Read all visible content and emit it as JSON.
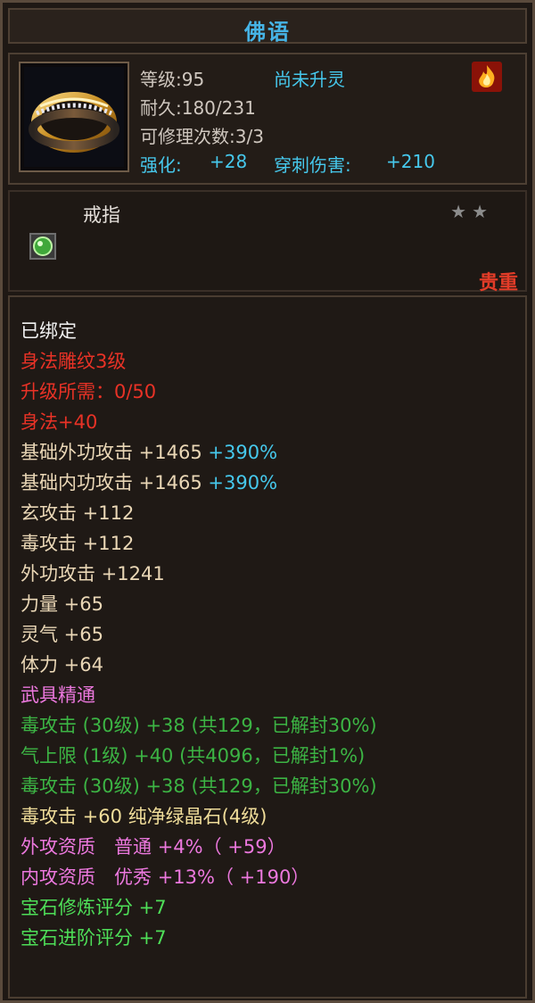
{
  "title": "佛语",
  "header": {
    "level_label": "等级:95",
    "spirit_status": "尚未升灵",
    "durability": "耐久:180/231",
    "repair_count": "可修理次数:3/3",
    "enhance_label": "强化:",
    "enhance_value": "+28",
    "pierce_label": "穿刺伤害:",
    "pierce_value": "+210"
  },
  "item_type": "戒指",
  "stars": "★★",
  "rarity": "贵重",
  "colors": {
    "title": "#46b4e6",
    "cyan": "#46c8ec",
    "red": "#e83226",
    "pink": "#ec78de",
    "green": "#3cb444",
    "bright_green": "#4ede58"
  },
  "icons": [
    "ring-item-icon",
    "fire-icon",
    "green-gem-icon"
  ],
  "attributes": {
    "bound": "已绑定",
    "carving": "身法雕纹3级",
    "upgrade_need": "升级所需：0/50",
    "agility": "身法+40",
    "base_ext_atk": "基础外功攻击 +1465",
    "base_ext_atk_pct": "+390%",
    "base_int_atk": "基础内功攻击 +1465",
    "base_int_atk_pct": "+390%",
    "xuan_atk": "玄攻击 +112",
    "poison_atk": "毒攻击 +112",
    "ext_atk": "外功攻击 +1241",
    "strength": "力量 +65",
    "spirit": "灵气 +65",
    "stamina": "体力 +64",
    "weapon_mastery": "武具精通",
    "mastery_1": "毒攻击 (30级) +38 (共129，已解封30%)",
    "mastery_2": "气上限 (1级) +40 (共4096，已解封1%)",
    "mastery_3": "毒攻击 (30级) +38 (共129，已解封30%)",
    "gem_line_left": "毒攻击 +60",
    "gem_line_right": "纯净绿晶石(4级)",
    "ext_aptitude_label": "外攻资质　普通",
    "ext_aptitude_value": "+4%（ +59）",
    "int_aptitude_label": "内攻资质　优秀",
    "int_aptitude_value": "+13%（ +190）",
    "gem_refine_score": "宝石修炼评分 +7",
    "gem_advance_score": "宝石进阶评分 +7"
  }
}
